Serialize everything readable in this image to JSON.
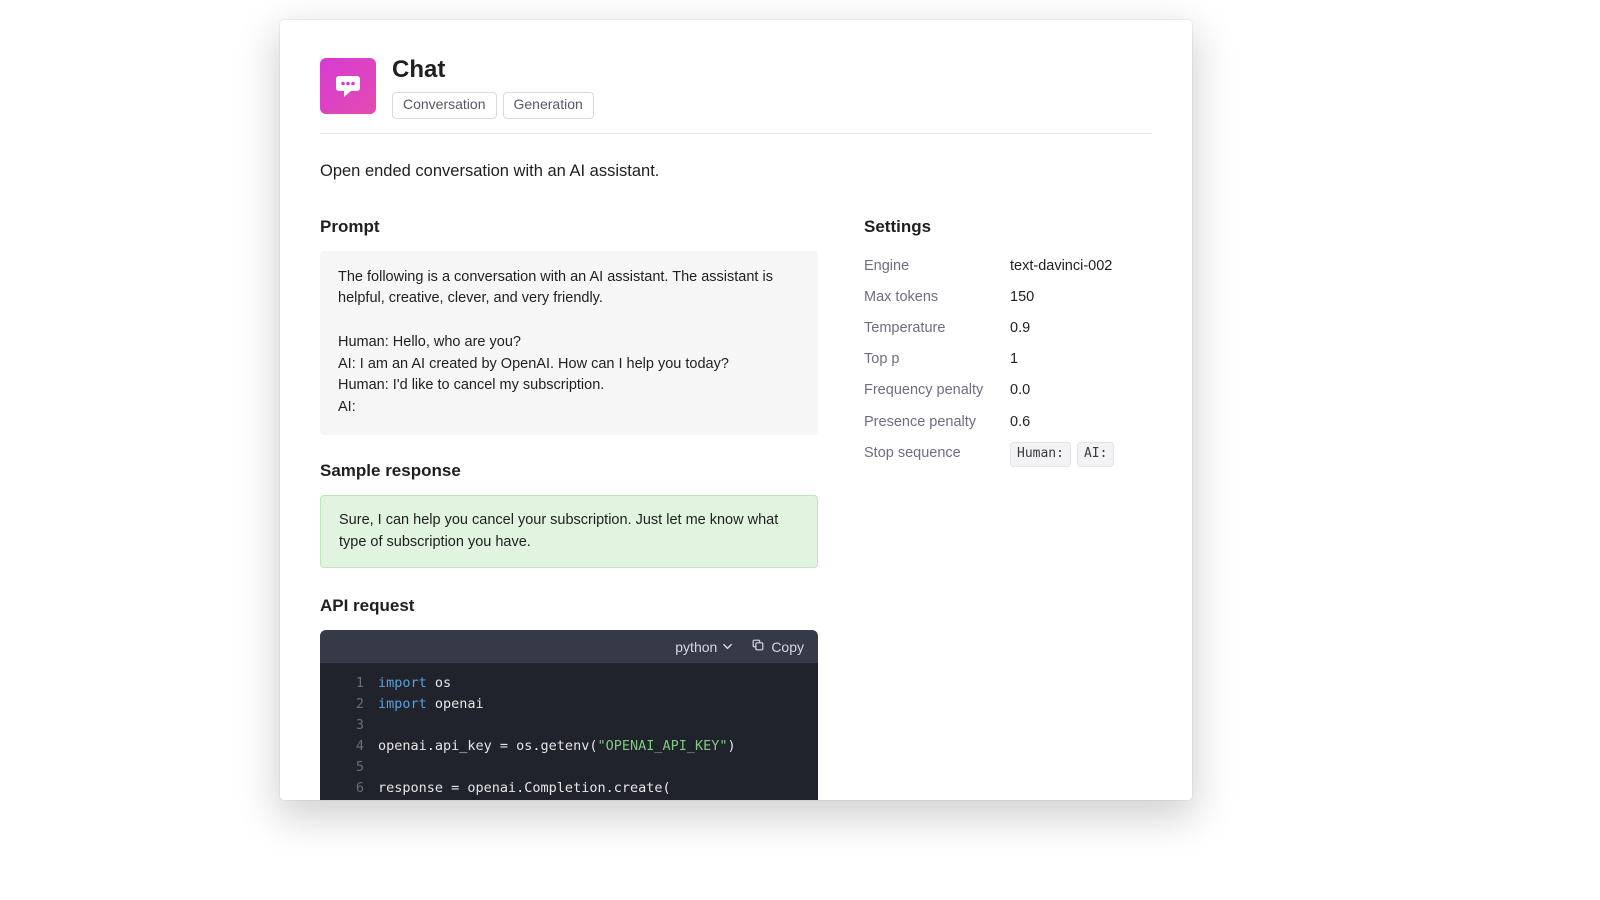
{
  "header": {
    "title": "Chat",
    "tags": [
      "Conversation",
      "Generation"
    ]
  },
  "description": "Open ended conversation with an AI assistant.",
  "prompt": {
    "heading": "Prompt",
    "text": "The following is a conversation with an AI assistant. The assistant is helpful, creative, clever, and very friendly.\n\nHuman: Hello, who are you?\nAI: I am an AI created by OpenAI. How can I help you today?\nHuman: I'd like to cancel my subscription.\nAI:"
  },
  "sample": {
    "heading": "Sample response",
    "text": "Sure, I can help you cancel your subscription. Just let me know what type of subscription you have."
  },
  "settings": {
    "heading": "Settings",
    "rows": [
      {
        "label": "Engine",
        "value": "text-davinci-002"
      },
      {
        "label": "Max tokens",
        "value": "150"
      },
      {
        "label": "Temperature",
        "value": "0.9"
      },
      {
        "label": "Top p",
        "value": "1"
      },
      {
        "label": "Frequency penalty",
        "value": "0.0"
      },
      {
        "label": "Presence penalty",
        "value": "0.6"
      }
    ],
    "stop_label": "Stop sequence",
    "stop_sequences": [
      "Human:",
      "AI:"
    ]
  },
  "api": {
    "heading": "API request",
    "language": "python",
    "copy_label": "Copy",
    "code_lines": [
      [
        {
          "t": "import ",
          "c": "kw"
        },
        {
          "t": "os",
          "c": ""
        }
      ],
      [
        {
          "t": "import ",
          "c": "kw"
        },
        {
          "t": "openai",
          "c": ""
        }
      ],
      [
        {
          "t": "",
          "c": ""
        }
      ],
      [
        {
          "t": "openai.api_key = os.getenv(",
          "c": ""
        },
        {
          "t": "\"OPENAI_API_KEY\"",
          "c": "str"
        },
        {
          "t": ")",
          "c": ""
        }
      ],
      [
        {
          "t": "",
          "c": ""
        }
      ],
      [
        {
          "t": "response = openai.Completion.create(",
          "c": ""
        }
      ]
    ]
  },
  "icons": {
    "chat": "chat-icon",
    "chevron_down": "chevron-down-icon",
    "copy": "copy-icon"
  },
  "colors": {
    "logo_gradient_from": "#d83bd3",
    "logo_gradient_to": "#e24bb0"
  }
}
